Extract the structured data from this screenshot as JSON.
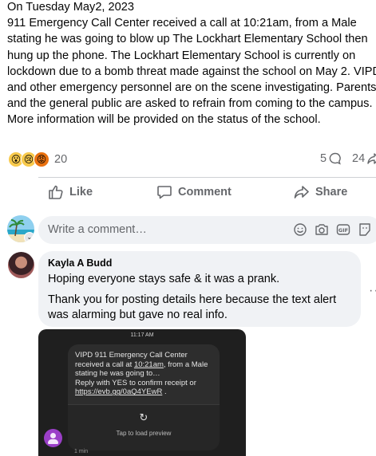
{
  "post": {
    "text": "On Tuesday May2, 2023\n911 Emergency Call Center received a call at 10:21am, from a Male stating he was going to blow up The Lockhart Elementary School then hung up the phone. The Lockhart Elementary School  is currently on lockdown due to a bomb threat made against the school on May 2. VIPD and other emergency personnel are on the scene investigating. Parents and the general public are asked to refrain from coming to the campus. More information will be provided on the status of the school."
  },
  "stats": {
    "reaction_icons": [
      "wow-emoji",
      "sad-emoji",
      "angry-emoji"
    ],
    "reaction_count": "20",
    "comment_count": "5",
    "share_count": "24"
  },
  "actions": {
    "like": "Like",
    "comment": "Comment",
    "share": "Share"
  },
  "composer": {
    "placeholder": "Write a comment…",
    "icons": [
      "emoji-icon",
      "camera-icon",
      "gif-icon",
      "sticker-icon"
    ]
  },
  "comment": {
    "author": "Kayla A Budd",
    "line1": "Hoping everyone stays safe & it was a prank.",
    "line2": "Thank you for posting details here because the text alert was alarming but gave no real info."
  },
  "attachment": {
    "status_time": "11:17 AM",
    "sms_line1": "VIPD 911 Emergency Call Center\nreceived a call at ",
    "sms_link_time": "10:21am",
    "sms_line2": ", from a Male\nstating he was going to…\nReply with YES to confirm receipt or\n",
    "sms_link_url": "https://evb.gg/0aQ4YEwR",
    "sms_line3": " .",
    "preview_label": "Tap to load preview",
    "timestamp": "1 min"
  },
  "colors": {
    "secondary_text": "#65676b",
    "bubble_bg": "#f0f2f5",
    "sms_avatar": "#9b3fc8"
  }
}
